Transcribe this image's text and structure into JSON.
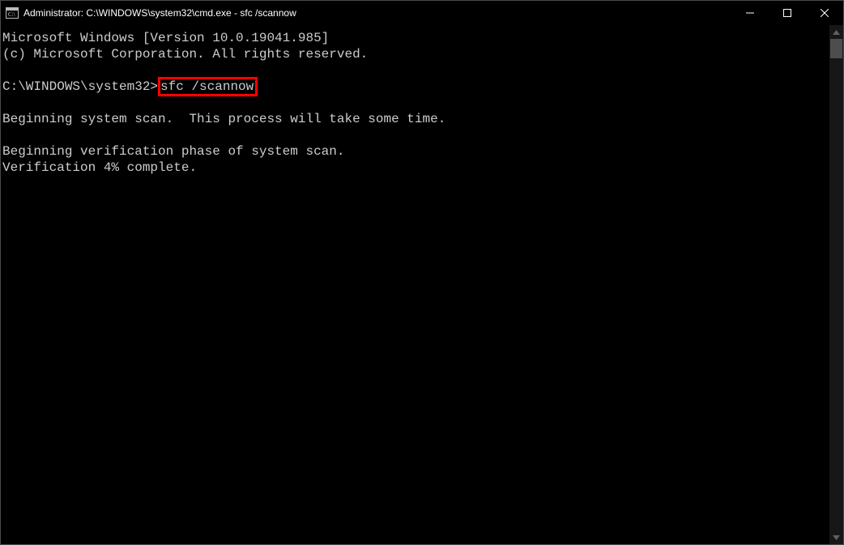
{
  "window": {
    "title": "Administrator: C:\\WINDOWS\\system32\\cmd.exe - sfc  /scannow"
  },
  "terminal": {
    "line1": "Microsoft Windows [Version 10.0.19041.985]",
    "line2": "(c) Microsoft Corporation. All rights reserved.",
    "blank1": "",
    "prompt": "C:\\WINDOWS\\system32>",
    "command": "sfc /scannow",
    "blank2": "",
    "line3": "Beginning system scan.  This process will take some time.",
    "blank3": "",
    "line4": "Beginning verification phase of system scan.",
    "line5": "Verification 4% complete."
  },
  "highlight_color": "#ff0000"
}
